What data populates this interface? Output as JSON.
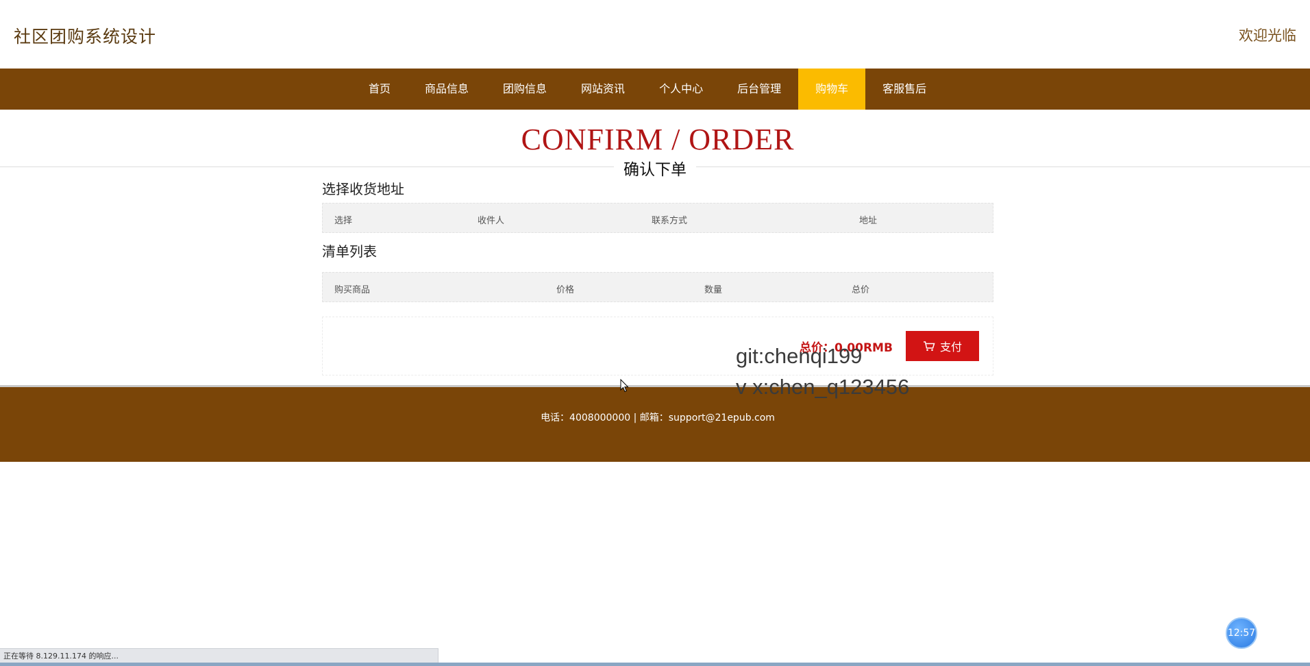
{
  "header": {
    "site_title": "社区团购系统设计",
    "welcome": "欢迎光临"
  },
  "nav": {
    "items": [
      {
        "label": "首页"
      },
      {
        "label": "商品信息"
      },
      {
        "label": "团购信息"
      },
      {
        "label": "网站资讯"
      },
      {
        "label": "个人中心"
      },
      {
        "label": "后台管理"
      },
      {
        "label": "购物车",
        "active": true
      },
      {
        "label": "客服售后"
      }
    ]
  },
  "page": {
    "title_en": "CONFIRM / ORDER",
    "title_cn": "确认下单"
  },
  "address": {
    "heading": "选择收货地址",
    "columns": [
      "选择",
      "收件人",
      "联系方式",
      "地址"
    ]
  },
  "order_list": {
    "heading": "清单列表",
    "columns": [
      "购买商品",
      "价格",
      "数量",
      "总价"
    ]
  },
  "summary": {
    "total": "总价：0.00RMB",
    "pay_label": "支付",
    "pay_icon": "cart-icon"
  },
  "footer": {
    "contact": "电话：4008000000 | 邮箱：support@21epub.com"
  },
  "watermark": {
    "line1": "git:chenqi199",
    "line2": "v x:chen_q123456"
  },
  "browser": {
    "status_text": "正在等待 8.129.11.174 的响应...",
    "clock": "12:57"
  },
  "colors": {
    "nav_bg": "#7a4508",
    "nav_active": "#fbbb00",
    "accent_red": "#b01515",
    "pay_button": "#d21414"
  }
}
